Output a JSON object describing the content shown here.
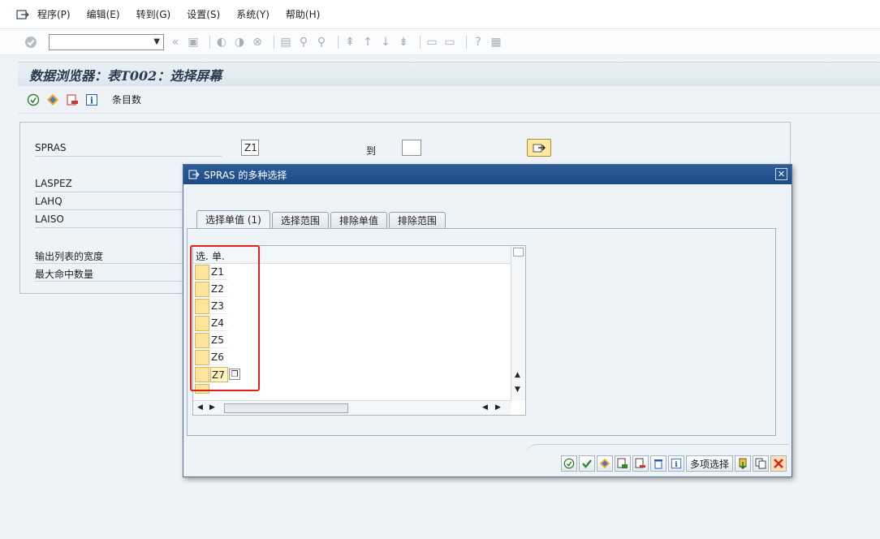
{
  "menu": {
    "items": [
      "程序(P)",
      "编辑(E)",
      "转到(G)",
      "设置(S)",
      "系统(Y)",
      "帮助(H)"
    ]
  },
  "screen": {
    "title": "数据浏览器：表T002：选择屏幕",
    "app_toolbar_label": "条目数"
  },
  "selection": {
    "fields": [
      {
        "label": "SPRAS",
        "value": "Z1"
      },
      {
        "label": "LASPEZ"
      },
      {
        "label": "LAHQ"
      },
      {
        "label": "LAISO"
      },
      {
        "label": "输出列表的宽度"
      },
      {
        "label": "最大命中数量"
      }
    ],
    "to_label": "到"
  },
  "dialog": {
    "title": "SPRAS 的多种选择",
    "tabs": [
      "选择单值 (1)",
      "选择范围",
      "排除单值",
      "排除范围"
    ],
    "grid": {
      "col_select": "选.",
      "col_single": "单.",
      "values": [
        "Z1",
        "Z2",
        "Z3",
        "Z4",
        "Z5",
        "Z6",
        "Z7"
      ]
    },
    "multi_select_label": "多项选择"
  },
  "colors": {
    "title_bar": "#1c4a85",
    "highlight": "#e0201e",
    "select_cell": "#ffe49a"
  }
}
